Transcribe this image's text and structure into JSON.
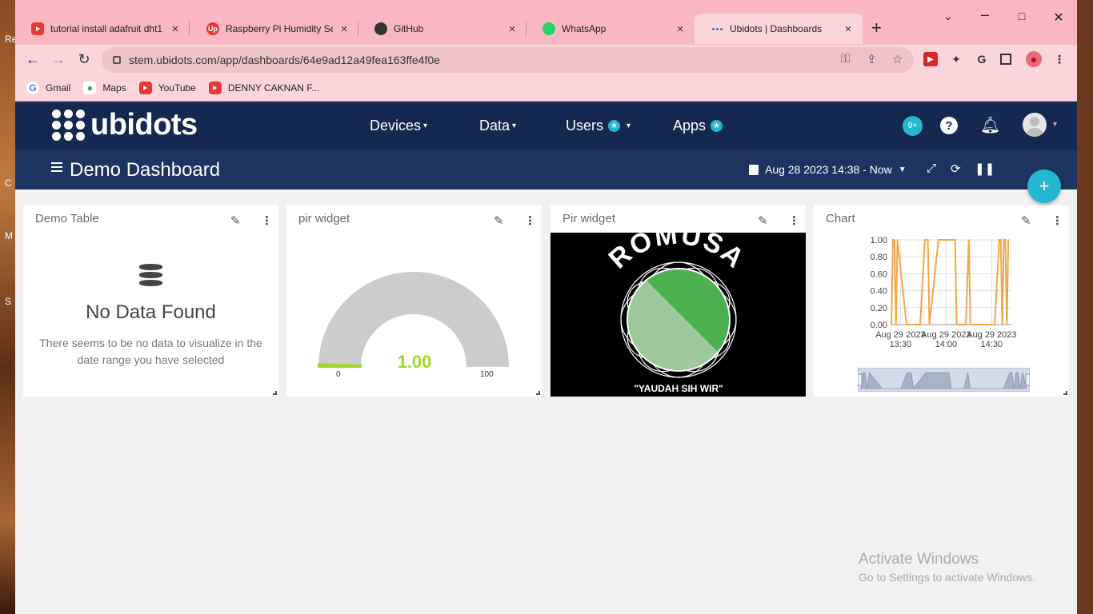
{
  "tabs": [
    {
      "title": "tutorial install adafruit dht1",
      "icon": "youtube-icon"
    },
    {
      "title": "Raspberry Pi Humidity Sens",
      "icon": "up-icon"
    },
    {
      "title": "GitHub",
      "icon": "github-icon"
    },
    {
      "title": "WhatsApp",
      "icon": "whatsapp-icon"
    },
    {
      "title": "Ubidots | Dashboards",
      "icon": "ubidots-icon"
    }
  ],
  "address": {
    "url": "stem.ubidots.com/app/dashboards/64e9ad12a49fea163ffe4f0e"
  },
  "bookmarks": [
    {
      "label": "Gmail"
    },
    {
      "label": "Maps"
    },
    {
      "label": "YouTube"
    },
    {
      "label": "DENNY CAKNAN F..."
    }
  ],
  "nav": {
    "logo": "ubidots",
    "devices": "Devices",
    "data": "Data",
    "users": "Users",
    "apps": "Apps",
    "notifications": "9+"
  },
  "dashboard": {
    "title": "Demo Dashboard",
    "date_range": "Aug 28 2023 14:38 - Now"
  },
  "widgets": {
    "table": {
      "title": "Demo Table",
      "empty_title": "No Data Found",
      "empty_text": "There seems to be no data to visualize in the date range you have selected"
    },
    "gauge": {
      "title": "pir widget",
      "value": "1.00",
      "min": "0",
      "max": "100",
      "value_numeric": 1.0,
      "color": "#a3d62d"
    },
    "image": {
      "title": "Pir widget",
      "top_text": "ROMUSA",
      "bottom_text": "\"YAUDAH SIH WIR\""
    },
    "chart": {
      "title": "Chart"
    }
  },
  "chart_data": {
    "type": "line",
    "y_ticks": [
      "1.00",
      "0.80",
      "0.60",
      "0.40",
      "0.20",
      "0.00"
    ],
    "x_ticks": [
      {
        "date": "Aug 29 2023",
        "time": "13:30"
      },
      {
        "date": "Aug 29 2023",
        "time": "14:00"
      },
      {
        "date": "Aug 29 2023",
        "time": "14:30"
      }
    ],
    "ylim": [
      0,
      1
    ],
    "xlim": [
      "13:24",
      "14:43"
    ],
    "grid": true,
    "color": "#f5a54a",
    "x": [
      "13:24",
      "13:25",
      "13:26",
      "13:27",
      "13:28",
      "13:34",
      "13:43",
      "13:46",
      "13:47",
      "13:48",
      "13:49",
      "13:55",
      "14:03",
      "14:06",
      "14:07",
      "14:13",
      "14:15",
      "14:16",
      "14:31",
      "14:32",
      "14:35",
      "14:36",
      "14:37",
      "14:38",
      "14:39",
      "14:40",
      "14:41"
    ],
    "y": [
      0,
      1,
      1,
      0,
      1,
      0,
      0,
      1,
      1,
      1,
      0,
      1,
      1,
      1,
      0,
      0,
      1,
      0,
      0,
      0,
      1,
      1,
      0,
      1,
      1,
      0,
      1
    ]
  },
  "desktop": {
    "fragments": [
      "Re",
      "C",
      "M",
      "S"
    ]
  },
  "watermark": {
    "line1": "Activate Windows",
    "line2": "Go to Settings to activate Windows."
  }
}
